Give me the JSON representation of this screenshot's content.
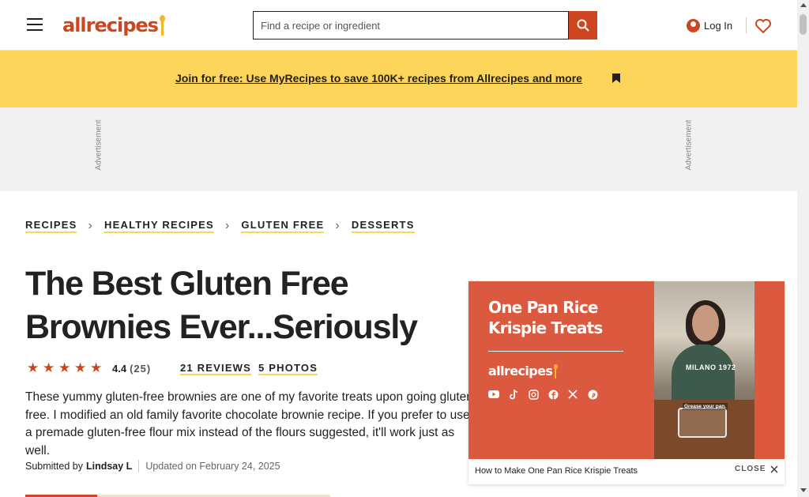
{
  "header": {
    "logo_text": "allrecipes",
    "search_placeholder": "Find a recipe or ingredient",
    "login_label": "Log In"
  },
  "promo": {
    "link_text": "Join for free: Use MyRecipes to save 100K+ recipes from Allrecipes and more"
  },
  "ad": {
    "label_left": "Advertisement",
    "label_right": "Advertisement"
  },
  "breadcrumb": [
    {
      "label": "RECIPES"
    },
    {
      "label": "HEALTHY RECIPES"
    },
    {
      "label": "GLUTEN FREE"
    },
    {
      "label": "DESSERTS"
    }
  ],
  "recipe": {
    "title": "The Best Gluten Free Brownies Ever...Seriously",
    "rating_value": "4.4",
    "rating_count": "(25)",
    "reviews_link": "21 REVIEWS",
    "photos_link": "5 PHOTOS",
    "description": "These yummy gluten-free brownies are one of my favorite treats upon going gluten-free. I modified an old family favorite chocolate brownie recipe. If you prefer to use a premade gluten-free flour mix instead of the flours suggested, it'll work just as well.",
    "submitted_by_label": "Submitted by",
    "author": "Lindsay L",
    "updated": "Updated on February 24, 2025"
  },
  "video": {
    "title": "One Pan Rice Krispie Treats",
    "logo_text": "allrecipes",
    "shirt_text": "MILANO 1972",
    "photo_caption": "Grease your pan.",
    "caption": "How to Make One Pan Rice Krispie Treats",
    "close_label": "CLOSE",
    "social_icons": [
      "youtube-icon",
      "tiktok-icon",
      "instagram-icon",
      "facebook-icon",
      "x-icon",
      "pinterest-icon"
    ]
  },
  "colors": {
    "brand": "#ce4620",
    "promo_bg": "#fcd55a",
    "video_panel": "#db5a3f"
  }
}
